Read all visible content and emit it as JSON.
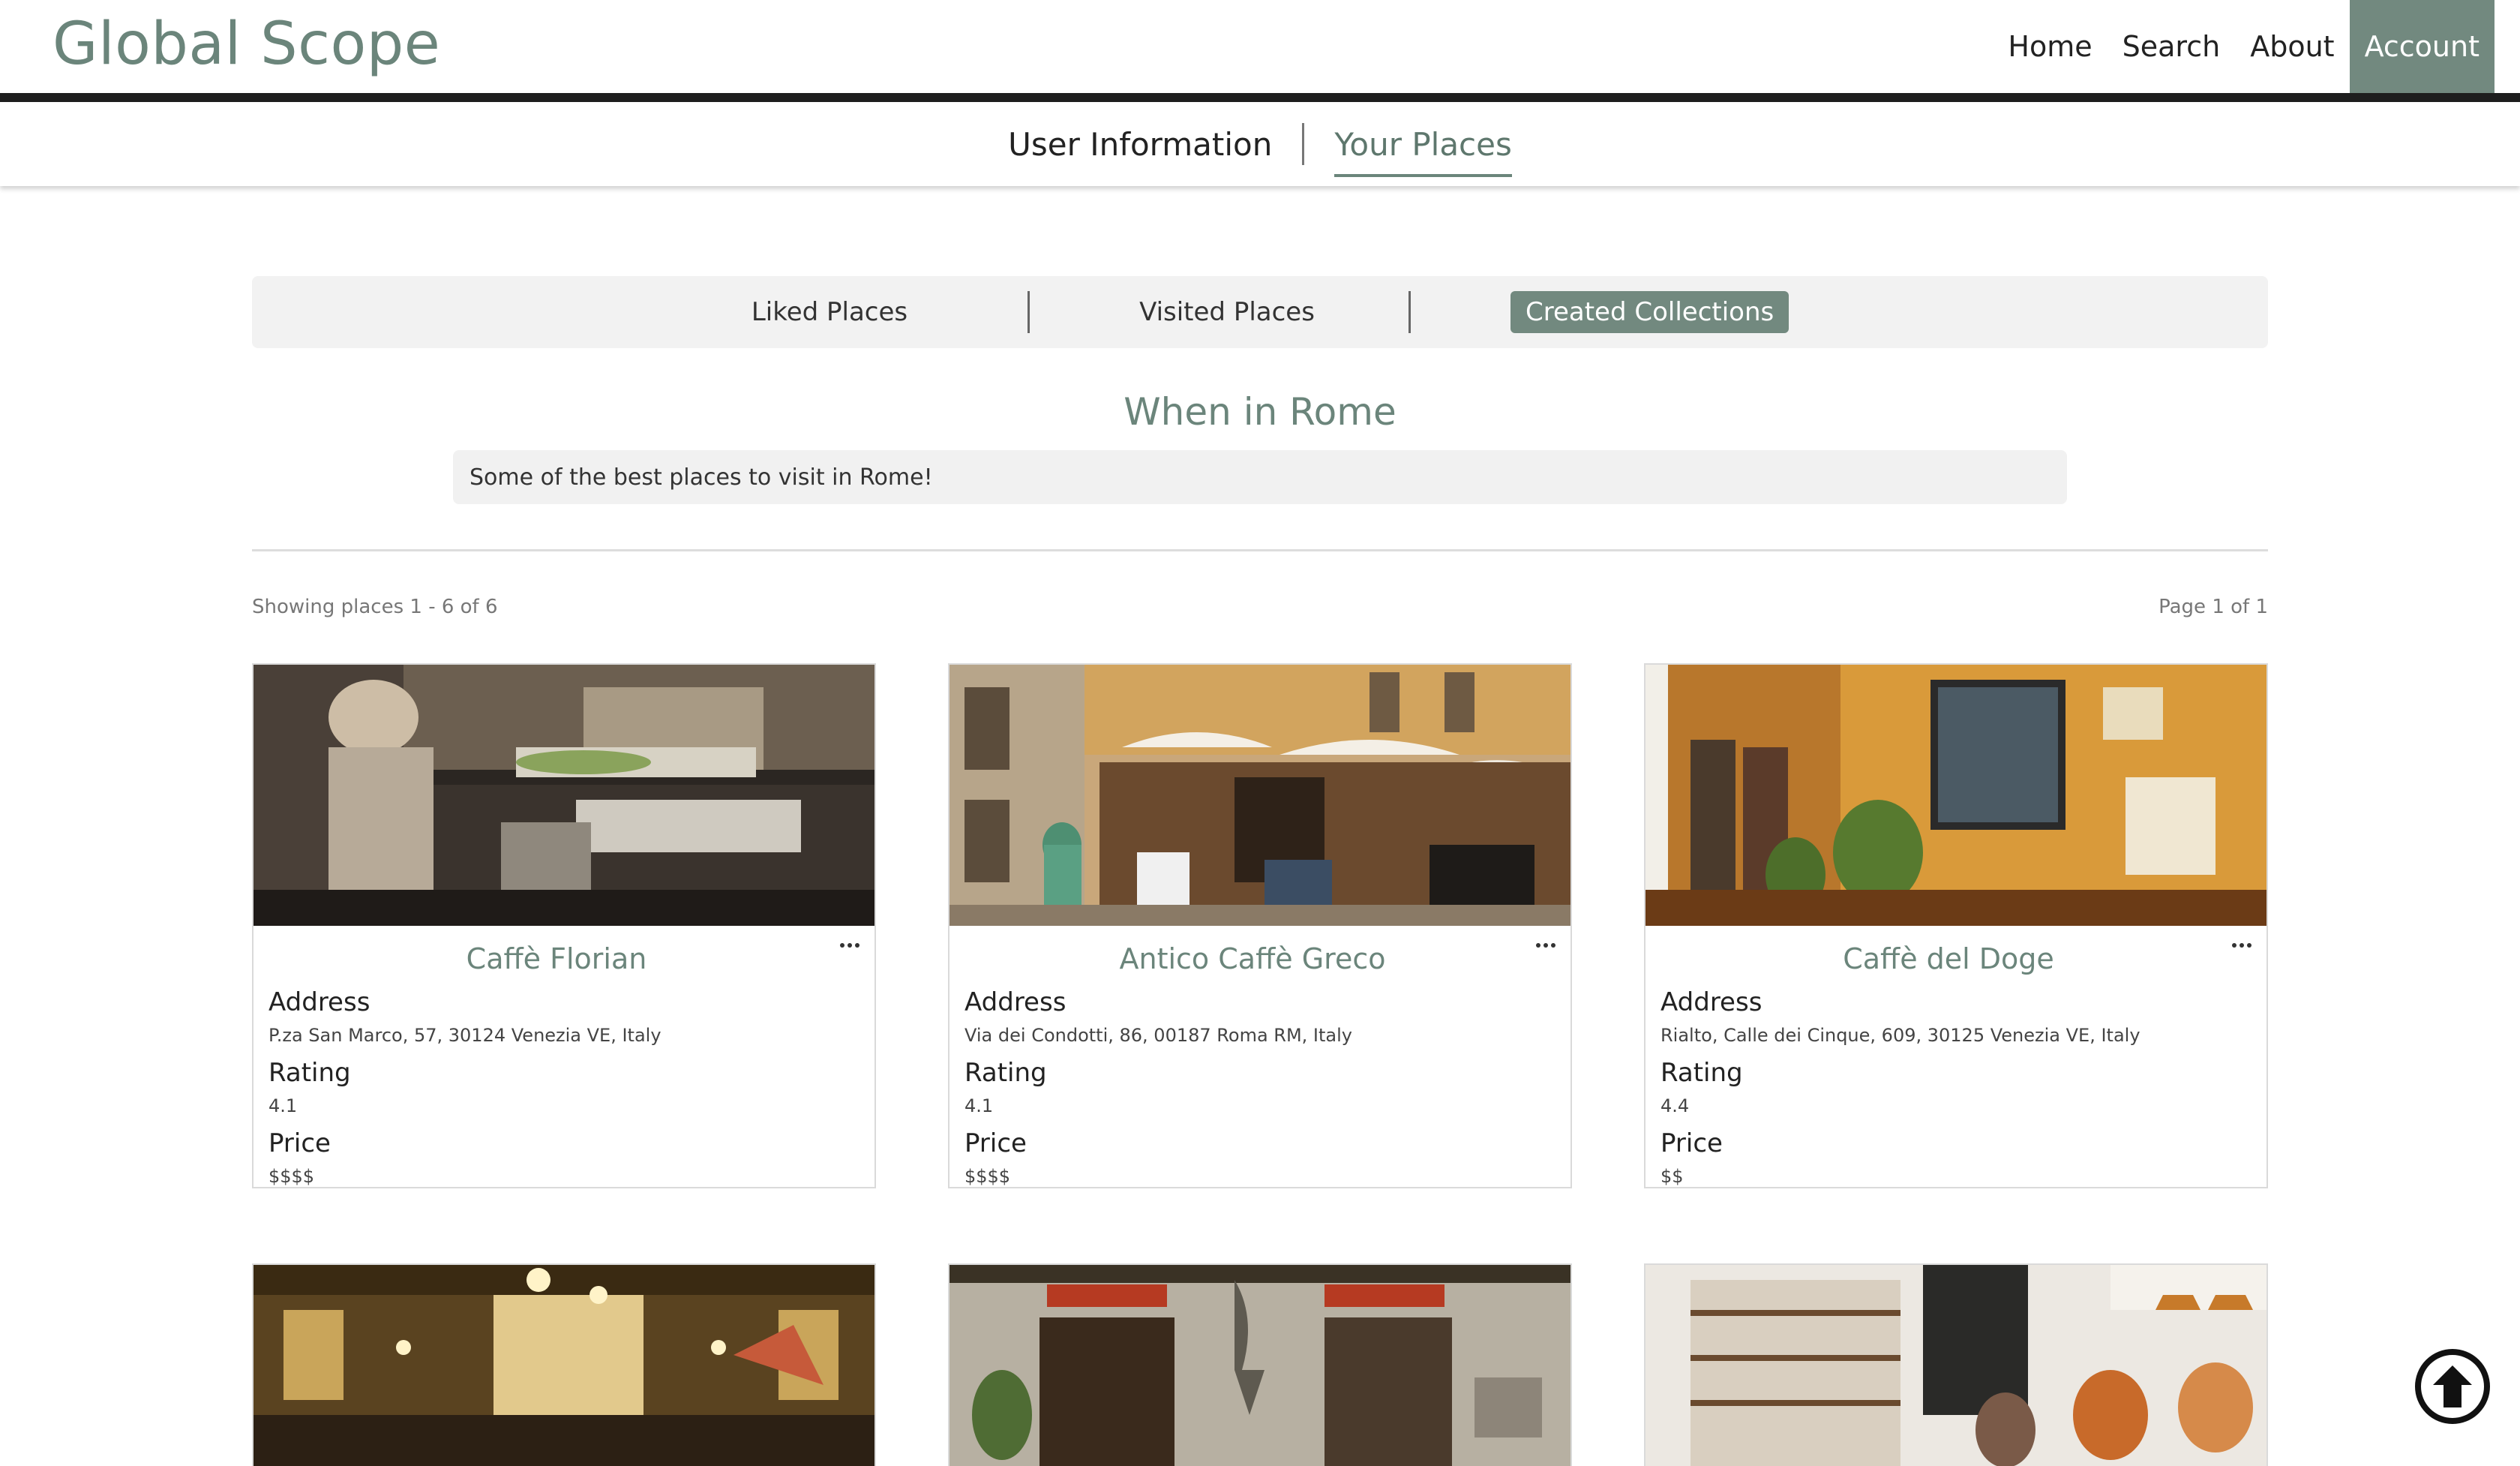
{
  "brand": "Global Scope",
  "nav": {
    "home": "Home",
    "search": "Search",
    "about": "About",
    "account": "Account"
  },
  "account_tabs": {
    "user_info": "User Information",
    "your_places": "Your Places"
  },
  "place_tabs": {
    "liked": "Liked Places",
    "visited": "Visited Places",
    "created": "Created Collections"
  },
  "collection": {
    "title": "When in Rome",
    "description": "Some of the best places to visit in Rome!"
  },
  "results": {
    "showing": "Showing places 1 - 6 of 6",
    "page": "Page 1 of 1"
  },
  "labels": {
    "address": "Address",
    "rating": "Rating",
    "price": "Price"
  },
  "places": [
    {
      "name": "Caffè Florian",
      "address": "P.za San Marco, 57, 30124 Venezia VE, Italy",
      "rating": "4.1",
      "price": "$$$$"
    },
    {
      "name": "Antico Caffè Greco",
      "address": "Via dei Condotti, 86, 00187 Roma RM, Italy",
      "rating": "4.1",
      "price": "$$$$"
    },
    {
      "name": "Caffè del Doge",
      "address": "Rialto, Calle dei Cinque, 609, 30125 Venezia VE, Italy",
      "rating": "4.4",
      "price": "$$"
    }
  ],
  "colors": {
    "accent": "#72897f",
    "brand_text": "#6b857b",
    "nav_rule": "#1e1e1e"
  },
  "icons": {
    "more": "more-horizontal-icon",
    "scroll_top": "arrow-up-circle-icon"
  }
}
